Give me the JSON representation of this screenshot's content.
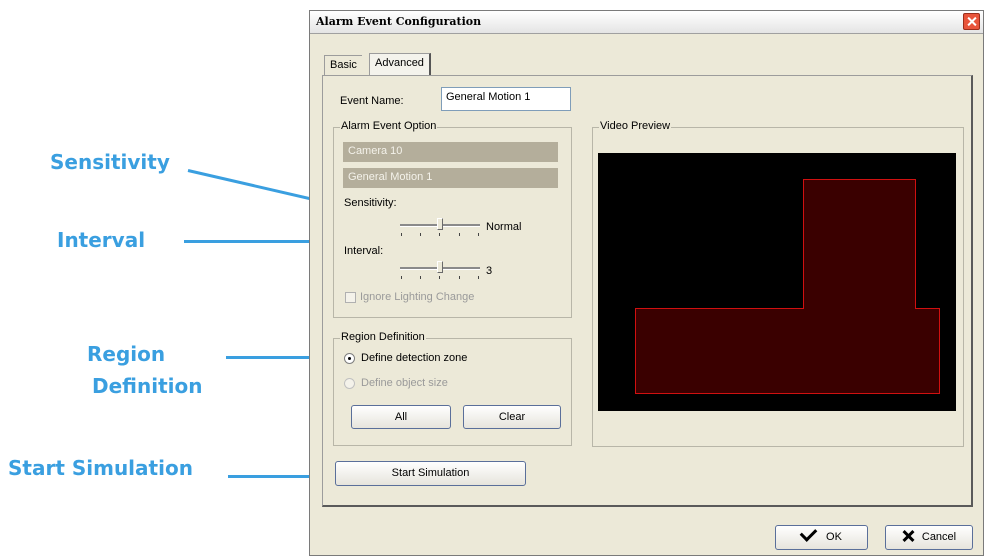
{
  "annotations": {
    "sensitivity": "Sensitivity",
    "interval": "Interval",
    "region_line1": "Region",
    "region_line2": "Definition",
    "start_simulation": "Start Simulation"
  },
  "dialog": {
    "title": "Alarm Event Configuration",
    "tabs": {
      "basic": "Basic",
      "advanced": "Advanced"
    },
    "event_name_label": "Event Name:",
    "event_name_value": "General Motion 1",
    "alarm_option": {
      "title": "Alarm Event Option",
      "camera": "Camera 10",
      "motion": "General Motion 1",
      "sensitivity_label": "Sensitivity:",
      "sensitivity_value": "Normal",
      "sensitivity_level": 0.5,
      "interval_label": "Interval:",
      "interval_value": "3",
      "interval_level": 0.5,
      "ignore_lighting": "Ignore Lighting Change"
    },
    "video_preview_title": "Video Preview",
    "region": {
      "title": "Region Definition",
      "define_zone": "Define detection zone",
      "define_object": "Define object size",
      "all_button": "All",
      "clear_button": "Clear"
    },
    "start_simulation_button": "Start Simulation",
    "ok_button": "OK",
    "cancel_button": "Cancel"
  },
  "colors": {
    "callout": "#3a9fe0",
    "zone_border": "#d01010",
    "zone_fill": "#3a0000"
  }
}
